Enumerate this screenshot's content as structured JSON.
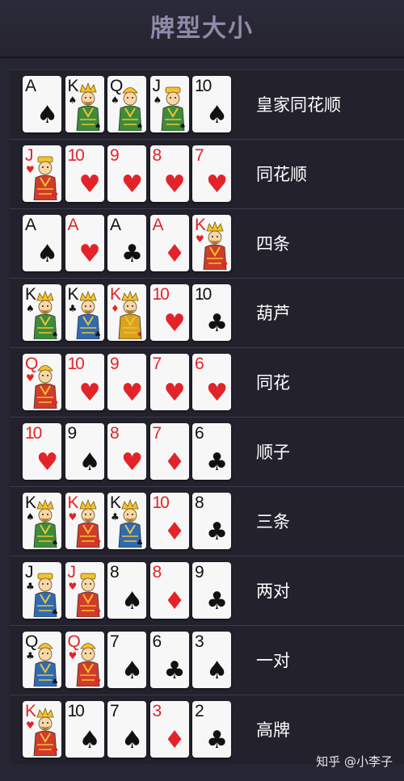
{
  "title": "牌型大小",
  "watermark": "知乎 @小李子",
  "colors": {
    "red": "#e2242a",
    "black": "#111111",
    "background": "#262533",
    "title": "#8f8aa8"
  },
  "hands": [
    {
      "name": "皇家同花顺",
      "cards": [
        {
          "rank": "A",
          "suit": "spade"
        },
        {
          "rank": "K",
          "suit": "spade"
        },
        {
          "rank": "Q",
          "suit": "spade"
        },
        {
          "rank": "J",
          "suit": "spade"
        },
        {
          "rank": "10",
          "suit": "spade"
        }
      ]
    },
    {
      "name": "同花顺",
      "cards": [
        {
          "rank": "J",
          "suit": "heart"
        },
        {
          "rank": "10",
          "suit": "heart"
        },
        {
          "rank": "9",
          "suit": "heart"
        },
        {
          "rank": "8",
          "suit": "heart"
        },
        {
          "rank": "7",
          "suit": "heart"
        }
      ]
    },
    {
      "name": "四条",
      "cards": [
        {
          "rank": "A",
          "suit": "spade"
        },
        {
          "rank": "A",
          "suit": "heart"
        },
        {
          "rank": "A",
          "suit": "club"
        },
        {
          "rank": "A",
          "suit": "diamond"
        },
        {
          "rank": "K",
          "suit": "heart"
        }
      ]
    },
    {
      "name": "葫芦",
      "cards": [
        {
          "rank": "K",
          "suit": "spade"
        },
        {
          "rank": "K",
          "suit": "club"
        },
        {
          "rank": "K",
          "suit": "diamond"
        },
        {
          "rank": "10",
          "suit": "heart"
        },
        {
          "rank": "10",
          "suit": "club"
        }
      ]
    },
    {
      "name": "同花",
      "cards": [
        {
          "rank": "Q",
          "suit": "heart"
        },
        {
          "rank": "10",
          "suit": "heart"
        },
        {
          "rank": "9",
          "suit": "heart"
        },
        {
          "rank": "7",
          "suit": "heart"
        },
        {
          "rank": "6",
          "suit": "heart"
        }
      ]
    },
    {
      "name": "顺子",
      "cards": [
        {
          "rank": "10",
          "suit": "heart"
        },
        {
          "rank": "9",
          "suit": "spade"
        },
        {
          "rank": "8",
          "suit": "heart"
        },
        {
          "rank": "7",
          "suit": "diamond"
        },
        {
          "rank": "6",
          "suit": "club"
        }
      ]
    },
    {
      "name": "三条",
      "cards": [
        {
          "rank": "K",
          "suit": "spade"
        },
        {
          "rank": "K",
          "suit": "heart"
        },
        {
          "rank": "K",
          "suit": "club"
        },
        {
          "rank": "10",
          "suit": "diamond"
        },
        {
          "rank": "8",
          "suit": "club"
        }
      ]
    },
    {
      "name": "两对",
      "cards": [
        {
          "rank": "J",
          "suit": "club"
        },
        {
          "rank": "J",
          "suit": "heart"
        },
        {
          "rank": "8",
          "suit": "spade"
        },
        {
          "rank": "8",
          "suit": "diamond"
        },
        {
          "rank": "9",
          "suit": "club"
        }
      ]
    },
    {
      "name": "一对",
      "cards": [
        {
          "rank": "Q",
          "suit": "club"
        },
        {
          "rank": "Q",
          "suit": "heart"
        },
        {
          "rank": "7",
          "suit": "spade"
        },
        {
          "rank": "6",
          "suit": "club"
        },
        {
          "rank": "3",
          "suit": "spade"
        }
      ]
    },
    {
      "name": "高牌",
      "cards": [
        {
          "rank": "K",
          "suit": "heart"
        },
        {
          "rank": "10",
          "suit": "spade"
        },
        {
          "rank": "7",
          "suit": "spade"
        },
        {
          "rank": "3",
          "suit": "diamond"
        },
        {
          "rank": "2",
          "suit": "club"
        }
      ]
    }
  ]
}
